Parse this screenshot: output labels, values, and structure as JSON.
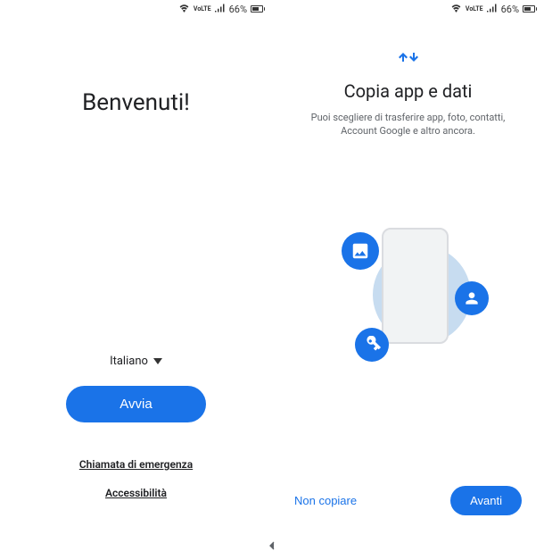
{
  "status": {
    "battery_percent": "66%"
  },
  "left": {
    "title": "Benvenuti!",
    "language": "Italiano",
    "start_button": "Avvia",
    "emergency_call": "Chiamata di emergenza",
    "accessibility": "Accessibilità"
  },
  "right": {
    "title": "Copia app e dati",
    "subtitle": "Puoi scegliere di trasferire app, foto, contatti, Account Google e altro ancora.",
    "skip_button": "Non copiare",
    "next_button": "Avanti"
  }
}
